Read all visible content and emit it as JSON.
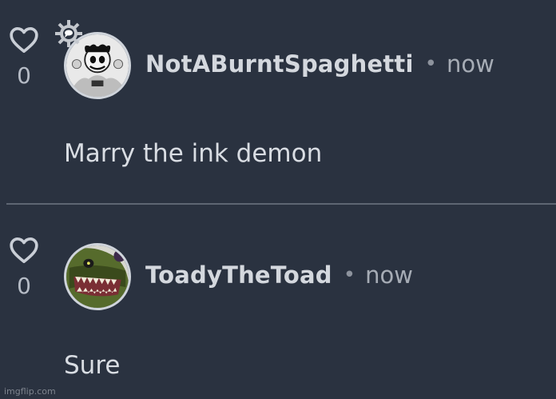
{
  "comments": [
    {
      "username": "NotABurntSpaghetti",
      "separator": "•",
      "time": "now",
      "likes": "0",
      "text": "Marry the ink demon",
      "has_badge": true
    },
    {
      "username": "ToadyTheToad",
      "separator": "•",
      "time": "now",
      "likes": "0",
      "text": "Sure",
      "has_badge": false
    }
  ],
  "watermark": "imgflip.com",
  "colors": {
    "background": "#2a3240",
    "username": "#d4d8de",
    "muted": "#a6acb5",
    "divider": "#5e6673"
  }
}
